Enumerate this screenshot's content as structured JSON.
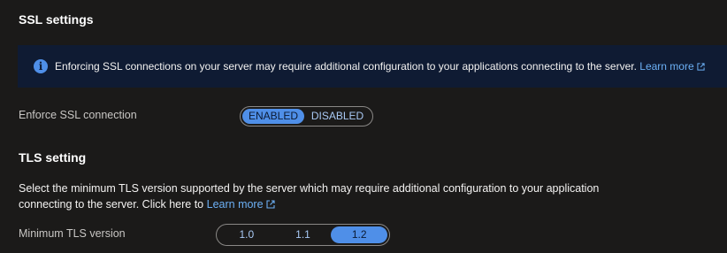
{
  "ssl_settings": {
    "title": "SSL settings",
    "banner": {
      "icon": "info-icon",
      "text": "Enforcing SSL connections on your server may require additional configuration to your applications connecting to the server.",
      "link_text": "Learn more",
      "link_icon": "external-link-icon"
    },
    "enforce_label": "Enforce SSL connection",
    "toggle": {
      "options": [
        "ENABLED",
        "DISABLED"
      ],
      "selected": "ENABLED"
    }
  },
  "tls_setting": {
    "title": "TLS setting",
    "description": "Select the minimum TLS version supported by the server which may require additional configuration to your application connecting to the server. Click here to",
    "link_text": "Learn more",
    "link_icon": "external-link-icon",
    "min_version_label": "Minimum TLS version",
    "versions": [
      "1.0",
      "1.1",
      "1.2"
    ],
    "selected": "1.2"
  },
  "colors": {
    "background": "#1b1a19",
    "banner": "#0f1b33",
    "accent": "#4f8fe8",
    "link": "#6cb0f5"
  }
}
